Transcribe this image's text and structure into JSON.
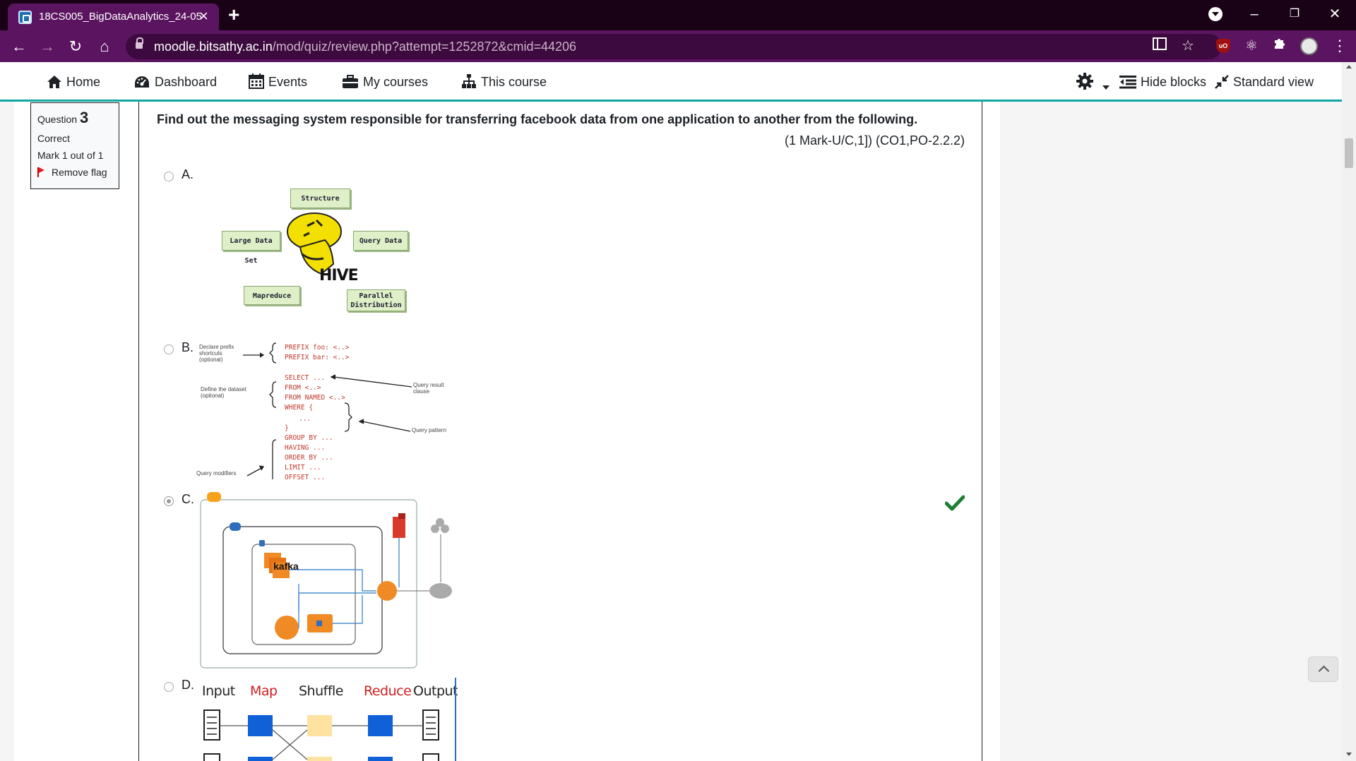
{
  "browser": {
    "tab_title": "18CS005_BigDataAnalytics_24-05",
    "url_host": "moodle.bitsathy.ac.in",
    "url_path": "/mod/quiz/review.php?attempt=1252872&cmid=44206",
    "icons": [
      "tab-favicon-icon",
      "close-icon",
      "plus-icon",
      "back-icon",
      "forward-icon",
      "reload-icon",
      "home-icon",
      "lock-icon",
      "reader-mode-icon",
      "star-icon",
      "ublock-icon",
      "atom-icon",
      "puzzle-icon",
      "avatar",
      "menu-icon"
    ]
  },
  "nav": {
    "home": "Home",
    "dashboard": "Dashboard",
    "events": "Events",
    "my_courses": "My courses",
    "this_course": "This course",
    "hide_blocks": "Hide blocks",
    "standard_view": "Standard view"
  },
  "question_info": {
    "label": "Question",
    "number": "3",
    "state": "Correct",
    "mark": "Mark 1 out of 1",
    "flag": "Remove flag"
  },
  "question": {
    "text": "Find out the messaging system responsible for transferring facebook data from one application to another from the following.",
    "marks": "(1 Mark-U/C,1]) (CO1,PO-2.2.2)",
    "options": [
      {
        "label": "A.",
        "selected": false
      },
      {
        "label": "B.",
        "selected": false
      },
      {
        "label": "C.",
        "selected": true,
        "correct": true
      },
      {
        "label": "D.",
        "selected": false
      }
    ]
  },
  "hive": {
    "structure": "Structure Data",
    "large": "Large Data Set",
    "query": "Query Data",
    "mapreduce": "Mapreduce",
    "parallel": "Parallel Distribution",
    "logo": "HIVE"
  },
  "sparql": {
    "prefix": "PREFIX foo: <..>\nPREFIX bar: <..>",
    "dataset": "SELECT ...\nFROM <..>\nFROM NAMED <..>\nWHERE {",
    "dots": "...",
    "modifiers": "}\nGROUP BY ...\nHAVING ...\nORDER BY ...\nLIMIT ...\nOFFSET ...",
    "note_prefix": "Declare prefix shortcuts (optional)",
    "note_dataset": "Define the dataset (optional)",
    "note_result": "Query result clause",
    "note_pattern": "Query pattern",
    "note_modifiers": "Query modifiers (optional)"
  },
  "kafka": {
    "logo": "kafka"
  },
  "mapreduce": {
    "input": "Input",
    "map": "Map",
    "shuffle": "Shuffle",
    "reduce": "Reduce",
    "output": "Output"
  },
  "colors": {
    "chrome_dark": "#1a0216",
    "chrome_tab": "#5b1560",
    "accent_teal": "#10a7a5",
    "correct_green": "#1e7e34"
  }
}
